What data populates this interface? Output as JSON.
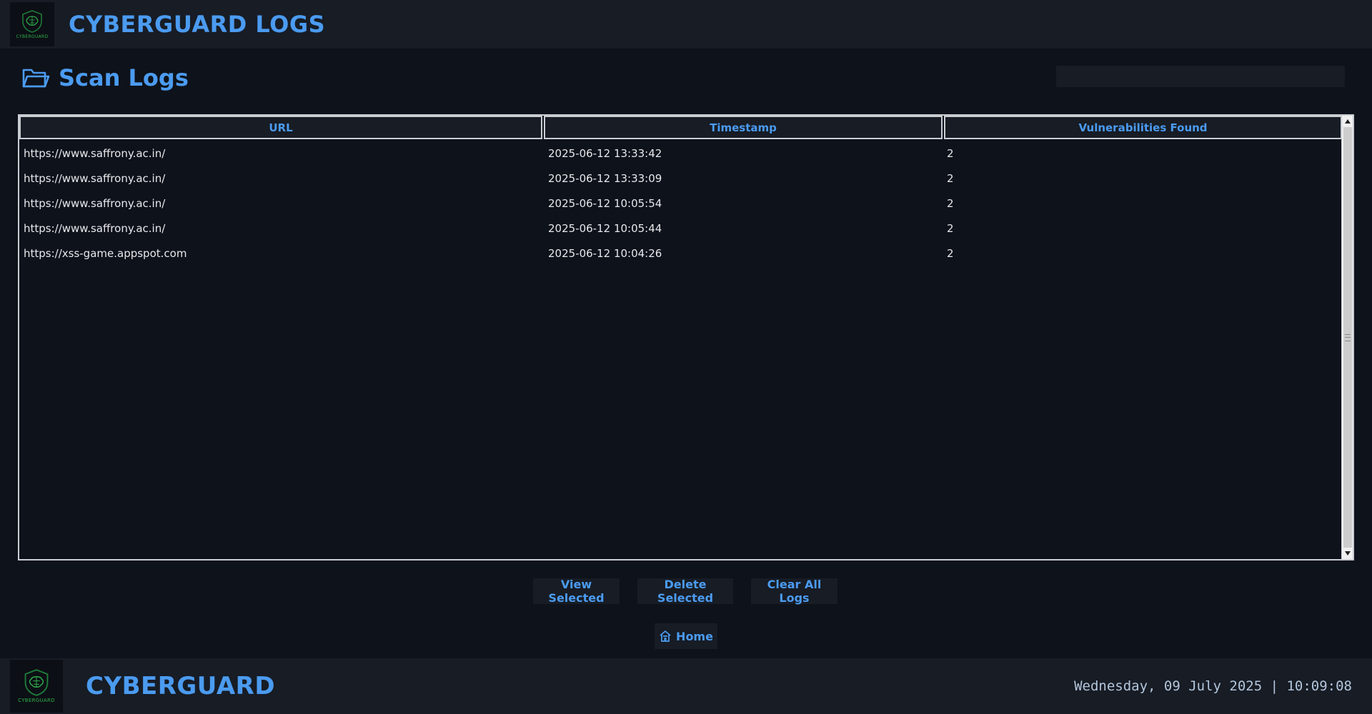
{
  "header": {
    "logo_text": "CYBERGUARD",
    "title": "CYBERGUARD LOGS"
  },
  "page": {
    "title": "Scan Logs",
    "search_value": ""
  },
  "table": {
    "columns": [
      "URL",
      "Timestamp",
      "Vulnerabilities Found"
    ],
    "rows": [
      {
        "url": "https://www.saffrony.ac.in/",
        "timestamp": "2025-06-12 13:33:42",
        "vulns": "2"
      },
      {
        "url": "https://www.saffrony.ac.in/",
        "timestamp": "2025-06-12 13:33:09",
        "vulns": "2"
      },
      {
        "url": "https://www.saffrony.ac.in/",
        "timestamp": "2025-06-12 10:05:54",
        "vulns": "2"
      },
      {
        "url": "https://www.saffrony.ac.in/",
        "timestamp": "2025-06-12 10:05:44",
        "vulns": "2"
      },
      {
        "url": "https://xss-game.appspot.com",
        "timestamp": "2025-06-12 10:04:26",
        "vulns": "2"
      }
    ]
  },
  "actions": {
    "view_label": "View Selected",
    "delete_label": "Delete Selected",
    "clear_label": "Clear All Logs",
    "home_label": "Home"
  },
  "footer": {
    "logo_text": "CYBERGUARD",
    "brand": "CYBERGUARD",
    "datetime": "Wednesday, 09 July 2025 | 10:09:08"
  },
  "colors": {
    "accent": "#4b9bf0",
    "background": "#0e121a",
    "panel": "#171c25",
    "logo_green": "#2fb04a"
  },
  "icons": {
    "logo": "shield-brain-icon",
    "page": "folder-icon",
    "home": "home-icon"
  }
}
